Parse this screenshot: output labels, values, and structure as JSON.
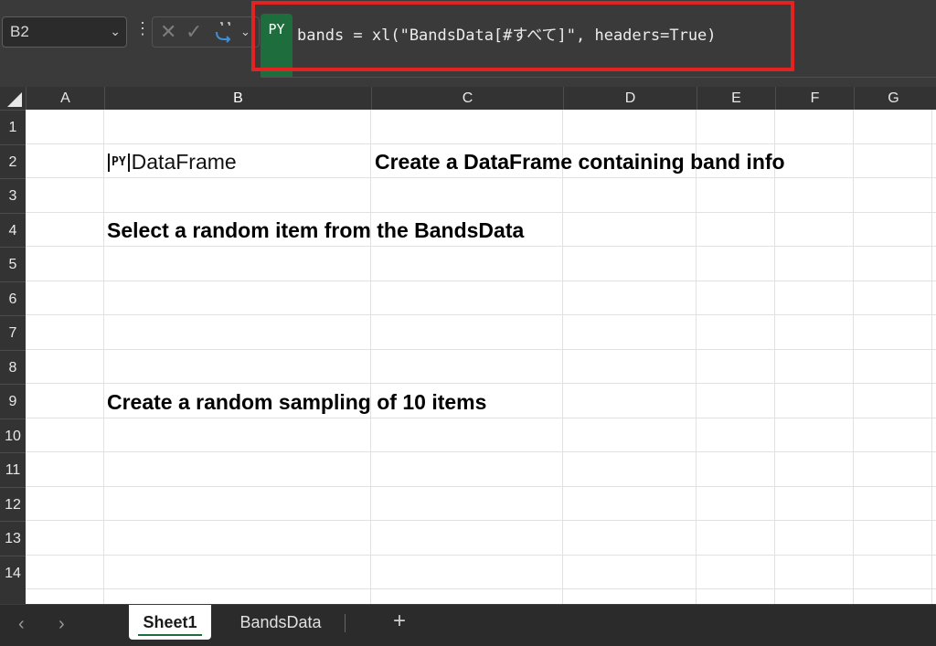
{
  "formula_bar": {
    "name_box": "B2",
    "py_badge": "PY",
    "formula": "bands = xl(\"BandsData[#すべて]\", headers=True)"
  },
  "columns": [
    "A",
    "B",
    "C",
    "D",
    "E",
    "F",
    "G"
  ],
  "selected_column": "B",
  "rows": [
    "1",
    "2",
    "3",
    "4",
    "5",
    "6",
    "7",
    "8",
    "9",
    "10",
    "11",
    "12",
    "13",
    "14"
  ],
  "cells": {
    "B2": "DataFrame",
    "B2_icon_text": "PY",
    "C2": "Create a DataFrame containing band info",
    "B4": "Select a random item from the BandsData",
    "B9": "Create a random sampling of 10 items"
  },
  "sheet_tabs": [
    {
      "label": "Sheet1",
      "active": true
    },
    {
      "label": "BandsData",
      "active": false
    }
  ],
  "add_sheet_label": "+",
  "theme": {
    "python_green": "#1e6e3d",
    "highlight_red": "#e32222",
    "chrome_dark": "#3a3a3a"
  }
}
